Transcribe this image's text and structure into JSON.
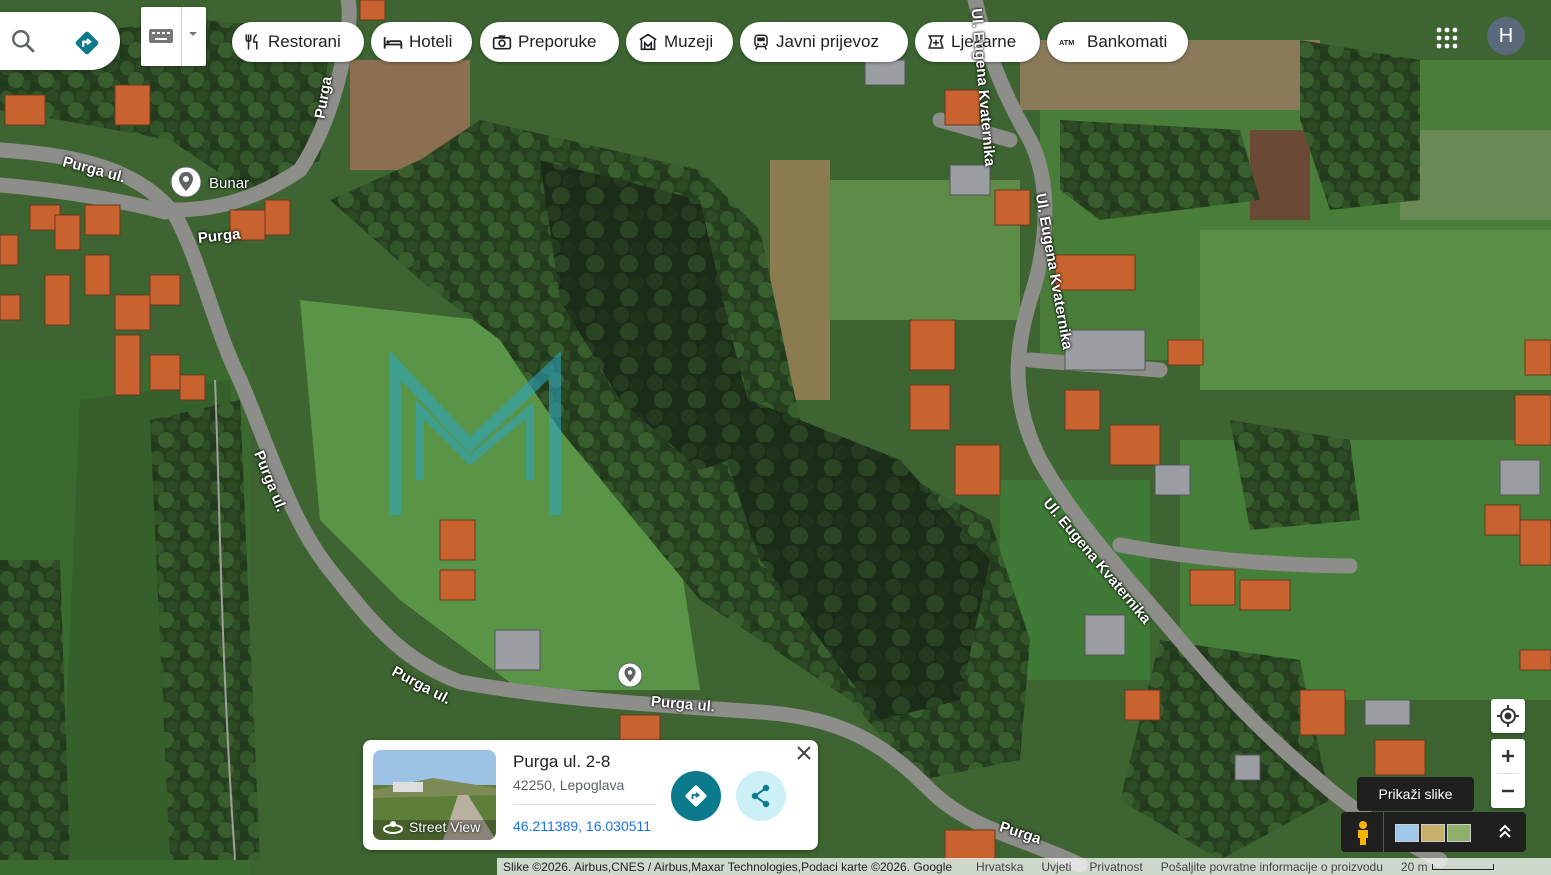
{
  "search": {
    "search_icon": "search-icon",
    "directions_icon": "directions-icon"
  },
  "keyboard": {
    "icon": "keyboard-icon"
  },
  "categories": [
    {
      "label": "Restorani",
      "icon": "restaurant-icon"
    },
    {
      "label": "Hoteli",
      "icon": "hotel-icon"
    },
    {
      "label": "Preporuke",
      "icon": "camera-icon"
    },
    {
      "label": "Muzeji",
      "icon": "museum-icon"
    },
    {
      "label": "Javni prijevoz",
      "icon": "transit-icon"
    },
    {
      "label": "Ljekarne",
      "icon": "pharmacy-icon"
    },
    {
      "label": "Bankomati",
      "icon": "atm-icon"
    }
  ],
  "account": {
    "initial": "H"
  },
  "map_labels": {
    "bunar": "Bunar",
    "purga_ul_1": "Purga ul.",
    "purga_1": "Purga",
    "purga_2": "Purga",
    "purga_ul_2": "Purga ul.",
    "purga_ul_3": "Purga ul.",
    "purga_ul_4": "Purga ul.",
    "purga_3": "Purga",
    "kvaternika_1": "Ul. Eugena Kvaternika",
    "kvaternika_2": "Ul. Eugena Kvaternika",
    "kvaternika_3": "Ul. Eugena Kvaternika"
  },
  "place_card": {
    "title": "Purga ul. 2-8",
    "address": "42250, Lepoglava",
    "coordinates": "46.211389, 16.030511",
    "street_view": "Street View"
  },
  "layers": {
    "tooltip": "Prikaži slike"
  },
  "footer": {
    "attribution": "Slike ©2026. Airbus,CNES / Airbus,Maxar Technologies,Podaci karte ©2026. Google",
    "country": "Hrvatska",
    "terms": "Uvjeti",
    "privacy": "Privatnost",
    "feedback": "Pošaljite povratne informacije o proizvodu",
    "scale": "20 m"
  },
  "colors": {
    "accent": "#0b7a8c",
    "link": "#1a73e8",
    "watermark": "#2aa7c9"
  }
}
